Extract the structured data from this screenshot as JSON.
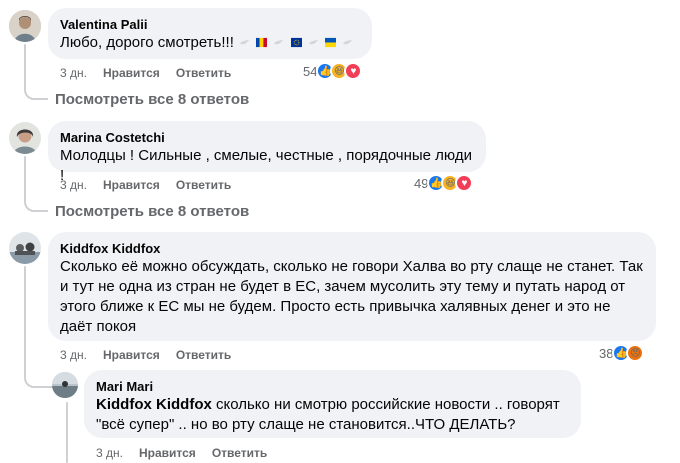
{
  "comments": [
    {
      "author": "Valentina Palii",
      "text": "Любо, дорого смотреть!!!",
      "time": "3 дн.",
      "like_label": "Нравится",
      "reply_label": "Ответить",
      "reaction_count": "54",
      "view_replies": "Посмотреть все 8 ответов"
    },
    {
      "author": "Marina Costetchi",
      "text": "Молодцы ! Сильные , смелые, честные , порядочные люди !",
      "time": "3 дн.",
      "like_label": "Нравится",
      "reply_label": "Ответить",
      "reaction_count": "49",
      "view_replies": "Посмотреть все 8 ответов"
    },
    {
      "author": "Kiddfox Kiddfox",
      "text": "Сколько её можно обсуждать, сколько не говори Халва во рту слаще не станет. Так и тут не одна из стран не будет в ЕС, зачем мусолить эту тему и путать народ от этого ближе к ЕС мы не будем. Просто есть привычка халявных денег и это не даёт покоя",
      "time": "3 дн.",
      "like_label": "Нравится",
      "reply_label": "Ответить",
      "reaction_count": "38"
    }
  ],
  "reply": {
    "author": "Mari Mari",
    "mention": "Kiddfox Kiddfox",
    "text": " сколько ни смотрю российские новости .. говорят \"всё супер\" .. но во рту слаще не становится..ЧТО ДЕЛАТЬ?",
    "time": "3 дн.",
    "like_label": "Нравится",
    "reply_label": "Ответить"
  },
  "colors": {
    "bubble": "#f0f2f5",
    "secondary_text": "#65676b",
    "like_blue": "#1877f2",
    "love_red": "#f33e58",
    "haha_yellow": "#f7b125",
    "angry_orange": "#e9710f"
  }
}
